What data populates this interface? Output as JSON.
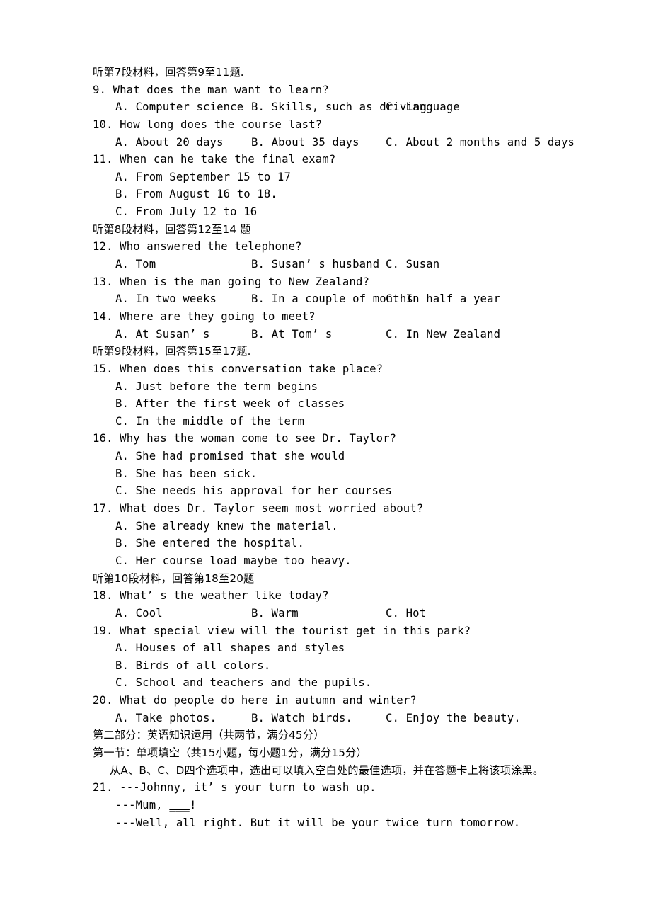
{
  "document": {
    "type": "exam-paper",
    "language_mix": "chinese-english",
    "lines": {
      "section_7_heading": "听第7段材料，回答第9至11题.",
      "q9_stem": "9. What does the man want to learn?",
      "q9_a": "A. Computer science",
      "q9_b": "B. Skills, such as driving",
      "q9_c": "C. Language",
      "q10_stem": "10. How long does the course last?",
      "q10_a": "A. About 20 days",
      "q10_b": "B. About 35 days",
      "q10_c": "C. About 2 months and 5 days",
      "q11_stem": "11. When can he take the final exam?",
      "q11_a": "A. From September 15 to 17",
      "q11_b": "B. From August 16 to 18.",
      "q11_c": "C. From July 12 to 16",
      "section_8_heading": "听第8段材料，回答第12至14 题",
      "q12_stem": "12. Who answered the telephone?",
      "q12_a": "A. Tom",
      "q12_b": "B. Susan’ s husband",
      "q12_c": "C. Susan",
      "q13_stem": "13. When is the man going to New Zealand?",
      "q13_a": "A. In two weeks",
      "q13_b": "B. In a couple of months",
      "q13_c": "C. In half a year",
      "q14_stem": "14. Where are they going to meet?",
      "q14_a": "A. At Susan’ s",
      "q14_b": "B. At Tom’ s",
      "q14_c": "C. In New Zealand",
      "section_9_heading": "听第9段材料，回答第15至17题.",
      "q15_stem": "15. When does this conversation take place?",
      "q15_a": "A. Just before the term begins",
      "q15_b": "B. After the first week of classes",
      "q15_c": "C. In the middle of the term",
      "q16_stem": "16. Why has the woman come to see Dr. Taylor?",
      "q16_a": "A. She had promised that she would",
      "q16_b": "B. She has been sick.",
      "q16_c": "C. She needs his approval for her courses",
      "q17_stem": "17. What does Dr. Taylor seem most worried about?",
      "q17_a": "A. She already knew the material.",
      "q17_b": "B. She entered the hospital.",
      "q17_c": "C. Her course load maybe too heavy.",
      "section_10_heading": "听第10段材料，回答第18至20题",
      "q18_stem": "18. What’ s the weather like today?",
      "q18_a": "A. Cool",
      "q18_b": "B. Warm",
      "q18_c": "C. Hot",
      "q19_stem": "19. What special view will the tourist get in this park?",
      "q19_a": "A. Houses of all shapes and styles",
      "q19_b": "B. Birds of all colors.",
      "q19_c": "C. School and teachers and the pupils.",
      "q20_stem": "20. What do people do here in autumn and winter?",
      "q20_a": "A. Take photos.",
      "q20_b": "B. Watch birds.",
      "q20_c": "C. Enjoy the beauty.",
      "part_two_heading": "第二部分：英语知识运用（共两节，满分45分）",
      "section_one_heading": "第一节：单项填空（共15小题，每小题1分，满分15分）",
      "section_one_instruction": "从A、B、C、D四个选项中，选出可以填入空白处的最佳选项，并在答题卡上将该项涂黑。",
      "q21_line1": "21. ---Johnny, it’ s your turn to wash up.",
      "q21_line2_prefix": "---Mum, ",
      "q21_line2_blank": "___",
      "q21_line2_suffix": "!",
      "q21_line3": "---Well, all right. But it will be your twice turn tomorrow."
    }
  }
}
